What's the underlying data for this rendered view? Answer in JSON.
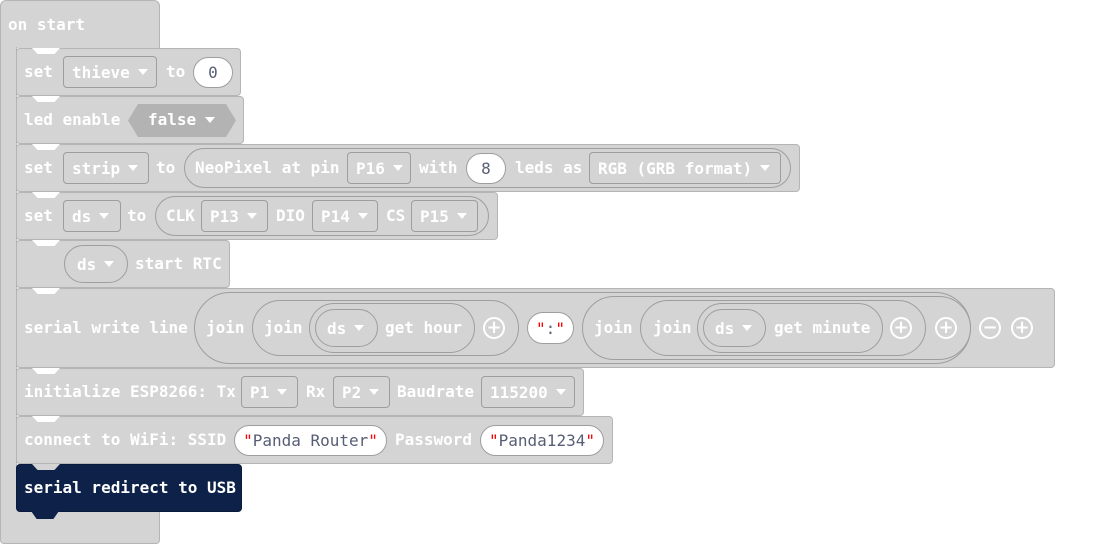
{
  "hat": {
    "label": "on start"
  },
  "b1": {
    "set": "set",
    "var": "thieve",
    "to": "to",
    "value": "0"
  },
  "b2": {
    "label": "led enable",
    "value": "false"
  },
  "b3": {
    "set": "set",
    "var": "strip",
    "to": "to",
    "np": "NeoPixel at pin",
    "pin": "P16",
    "with": "with",
    "count": "8",
    "leds": "leds as",
    "mode": "RGB (GRB format)"
  },
  "b4": {
    "set": "set",
    "var": "ds",
    "to": "to",
    "clk": "CLK",
    "clk_pin": "P13",
    "dio": "DIO",
    "dio_pin": "P14",
    "cs": "CS",
    "cs_pin": "P15"
  },
  "b5": {
    "var": "ds",
    "label": "start RTC"
  },
  "b6": {
    "label": "serial write line",
    "join": "join",
    "var": "ds",
    "hour": "get hour",
    "sep": ":",
    "minute": "get minute"
  },
  "b7": {
    "label": "initialize ESP8266: Tx",
    "tx": "P1",
    "rx_label": "Rx",
    "rx": "P2",
    "baud_label": "Baudrate",
    "baud": "115200"
  },
  "b8": {
    "label": "connect to WiFi: SSID",
    "ssid": "Panda Router",
    "pass_label": "Password",
    "password": "Panda1234"
  },
  "b9": {
    "label": "serial redirect to USB"
  },
  "colors": {
    "block": "#d4d4d4",
    "dark_block": "#0d2149",
    "text": "#ffffff",
    "string_quote": "#ff0000"
  },
  "icons": [
    "dropdown-arrow-icon",
    "plus-icon",
    "minus-icon"
  ]
}
